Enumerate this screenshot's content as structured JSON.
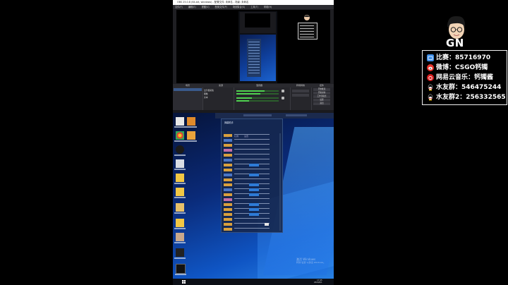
{
  "obs": {
    "window_title": "OBS 25.0.8 (64-bit, windows) - 配置文件: 未命名 - 场景: 未命名",
    "menu": [
      "文件(F)",
      "编辑(E)",
      "视图(V)",
      "配置文件(P)",
      "场景集合(S)",
      "工具(T)",
      "帮助(H)"
    ],
    "docks": {
      "scenes": "场景",
      "sources": "来源",
      "mixer": "混音器",
      "transitions": "转场特效",
      "controls": "控件"
    },
    "source_items": [
      "显示器采集",
      "图像",
      "文本"
    ],
    "controls_buttons": [
      "开始推流",
      "开始录制",
      "工作室模式",
      "设置",
      "退出"
    ]
  },
  "desktop": {
    "chat_title": "弹幕助手",
    "tabs": [
      "弹幕",
      "礼物",
      "设置"
    ],
    "watermark_line1": "激活 Windows",
    "watermark_line2": "转到\"设置\"以激活 Windows。",
    "clock_time": "17:45",
    "clock_date": "2020/6/1"
  },
  "overlay": {
    "logo_text": "GN",
    "rows": [
      {
        "icon": "bilibili-icon",
        "text": "比赛：85716970",
        "color": "#3d8ee8"
      },
      {
        "icon": "weibo-icon",
        "text": "微博：CSGO钙镯",
        "color": "#e8332a"
      },
      {
        "icon": "netease-music-icon",
        "text": "网易云音乐：钙镯酱",
        "color": "#d81e1e"
      },
      {
        "icon": "qq-icon",
        "text": "水友群：546475244",
        "color": "#f4c51f"
      },
      {
        "icon": "qq-icon",
        "text": "水友群2：256332565",
        "color": "#f4c51f"
      }
    ]
  }
}
